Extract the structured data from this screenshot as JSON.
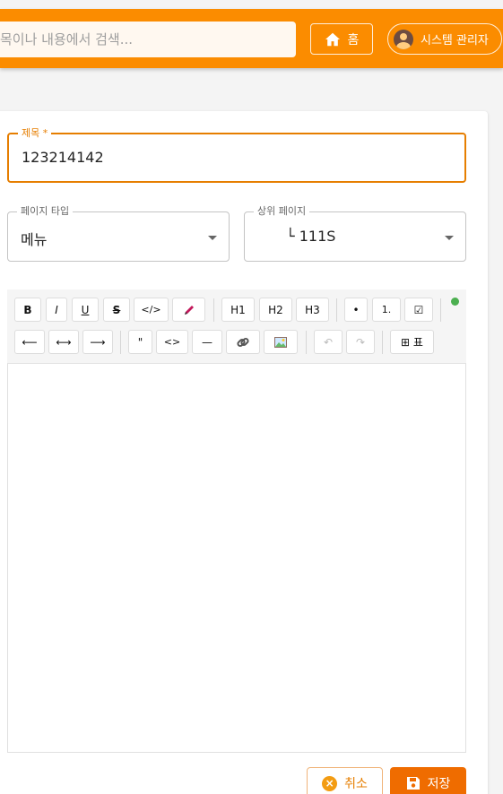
{
  "header": {
    "search_placeholder": "목이나 내용에서 검색...",
    "home_label": "홈",
    "user_label": "시스템 관리자"
  },
  "form": {
    "title_label": "제목 *",
    "title_value": "123214142",
    "page_type_label": "페이지 타입",
    "page_type_value": "메뉴",
    "parent_label": "상위 페이지",
    "parent_value": "└ 111S"
  },
  "toolbar": {
    "row1": [
      "B",
      "I",
      "U",
      "S",
      "</>",
      "H1",
      "H2",
      "H3",
      "•",
      "1.",
      "☑"
    ],
    "row2": [
      "⟵",
      "⟷",
      "⟶",
      "\"",
      "<>",
      "—",
      "↶",
      "↷",
      "⊞ 표"
    ],
    "status_color": "#4caf50"
  },
  "actions": {
    "cancel_label": "취소",
    "save_label": "저장"
  },
  "colors": {
    "brand": "#fb8c00",
    "accent": "#e67e00",
    "save": "#ef6c00"
  }
}
